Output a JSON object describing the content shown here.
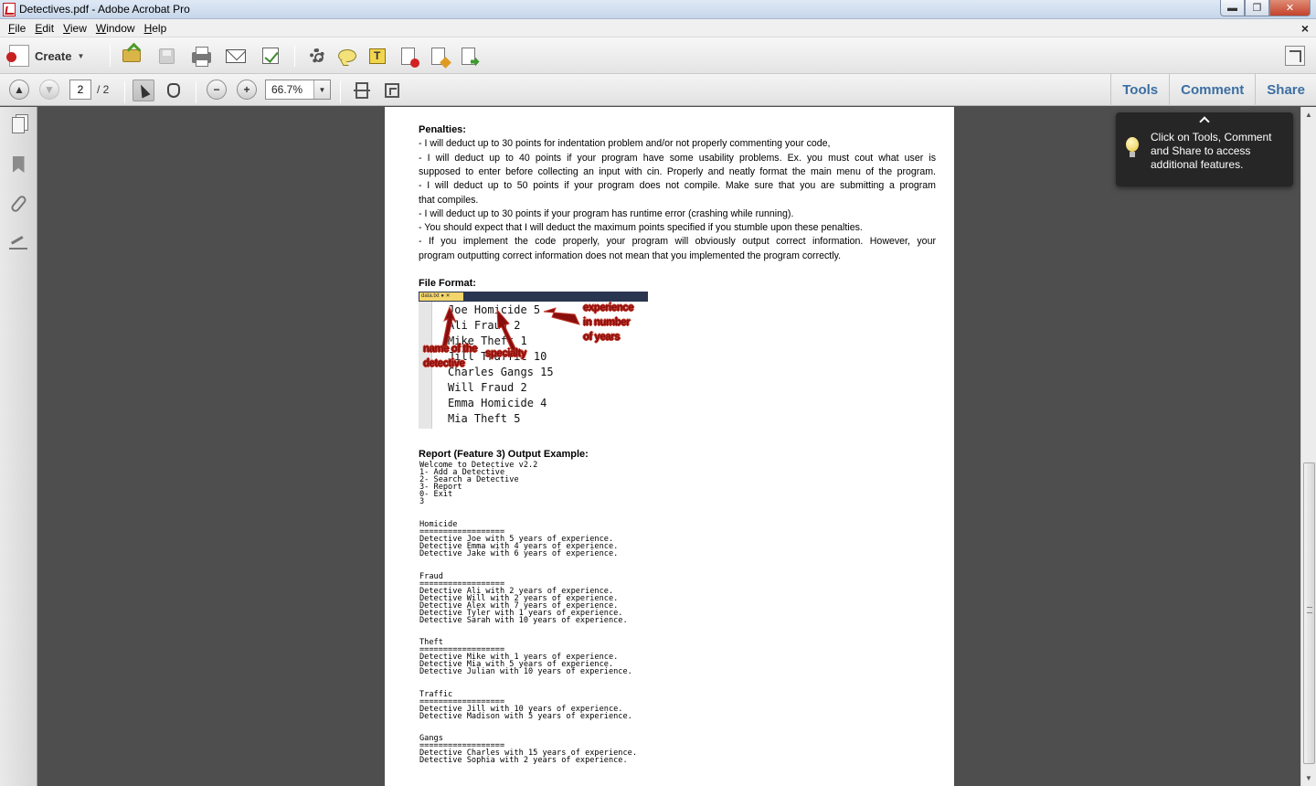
{
  "window": {
    "title": "Detectives.pdf - Adobe Acrobat Pro",
    "minimize": "▬",
    "restore": "❐",
    "close": "✕"
  },
  "menu": {
    "items": [
      "File",
      "Edit",
      "View",
      "Window",
      "Help"
    ],
    "doc_close": "×"
  },
  "toolbar": {
    "create_label": "Create",
    "create_caret": "▼",
    "icons": [
      "open-icon",
      "save-icon",
      "print-icon",
      "email-icon",
      "form-icon",
      "settings-icon",
      "comment-icon",
      "text-note-icon",
      "delete-page-icon",
      "extract-page-icon",
      "insert-page-icon"
    ]
  },
  "nav": {
    "prev": "▲",
    "next": "▼",
    "page_current": "2",
    "page_total": "/ 2",
    "zoom_out": "−",
    "zoom_in": "+",
    "zoom": "66.7%",
    "zoom_caret": "▼"
  },
  "panels": {
    "tools": "Tools",
    "comment": "Comment",
    "share": "Share"
  },
  "tooltip": {
    "text": "Click on Tools, Comment and Share to access additional features."
  },
  "document": {
    "penalties_title": "Penalties:",
    "penalties": [
      "- I will deduct up to 30 points for indentation problem and/or not properly commenting your code,",
      "- I will deduct up to 40 points if your program have some usability problems. Ex. you must cout what user is",
      "supposed to enter before collecting an input with cin. Properly and neatly format the main menu of the program.",
      "- I will deduct up to 50 points if your program does not compile. Make sure that you are submitting a program",
      "that compiles.",
      "- I will deduct up to 30 points if your program has runtime error (crashing while running).",
      "- You should expect that I will deduct the maximum points specified if you stumble upon these penalties.",
      "- If you implement the code properly, your program will obviously output correct information. However, your",
      "program outputting correct information does not mean that you implemented the program correctly."
    ],
    "file_format_title": "File Format:",
    "editor_tab": "data.txt  ●  ✕",
    "file_lines": [
      "Joe Homicide 5",
      "Ali Fraud 2",
      "Mike Theft 1",
      "Jill Traffic 10",
      "Charles Gangs 15",
      "Will Fraud 2",
      "Emma Homicide 4",
      "Mia Theft 5"
    ],
    "annotations": {
      "experience": "experience\nin number\nof years",
      "name": "name of the\ndetective",
      "specialty": "specialty"
    },
    "report_title": "Report (Feature 3) Output Example:",
    "report_menu": [
      "Welcome to Detective v2.2",
      "1- Add a Detective",
      "2- Search a Detective",
      "3- Report",
      "0- Exit",
      "3"
    ],
    "groups": [
      {
        "name": "Homicide",
        "rule": "==================",
        "lines": [
          "Detective Joe with 5 years of experience.",
          "Detective Emma with 4 years of experience.",
          "Detective Jake with 6 years of experience."
        ]
      },
      {
        "name": "Fraud",
        "rule": "==================",
        "lines": [
          "Detective Ali with 2 years of experience.",
          "Detective Will with 2 years of experience.",
          "Detective Alex with 7 years of experience.",
          "Detective Tyler with 1 years of experience.",
          "Detective Sarah with 10 years of experience."
        ]
      },
      {
        "name": "Theft",
        "rule": "==================",
        "lines": [
          "Detective Mike with 1 years of experience.",
          "Detective Mia with 5 years of experience.",
          "Detective Julian with 10 years of experience."
        ]
      },
      {
        "name": "Traffic",
        "rule": "==================",
        "lines": [
          "Detective Jill with 10 years of experience.",
          "Detective Madison with 5 years of experience."
        ]
      },
      {
        "name": "Gangs",
        "rule": "==================",
        "lines": [
          "Detective Charles with 15 years of experience.",
          "Detective Sophia with 2 years of experience."
        ]
      }
    ]
  },
  "colors": {
    "annotation": "#8a0d0d",
    "link": "#3b6fa3",
    "tooltip_bg": "#262626"
  }
}
